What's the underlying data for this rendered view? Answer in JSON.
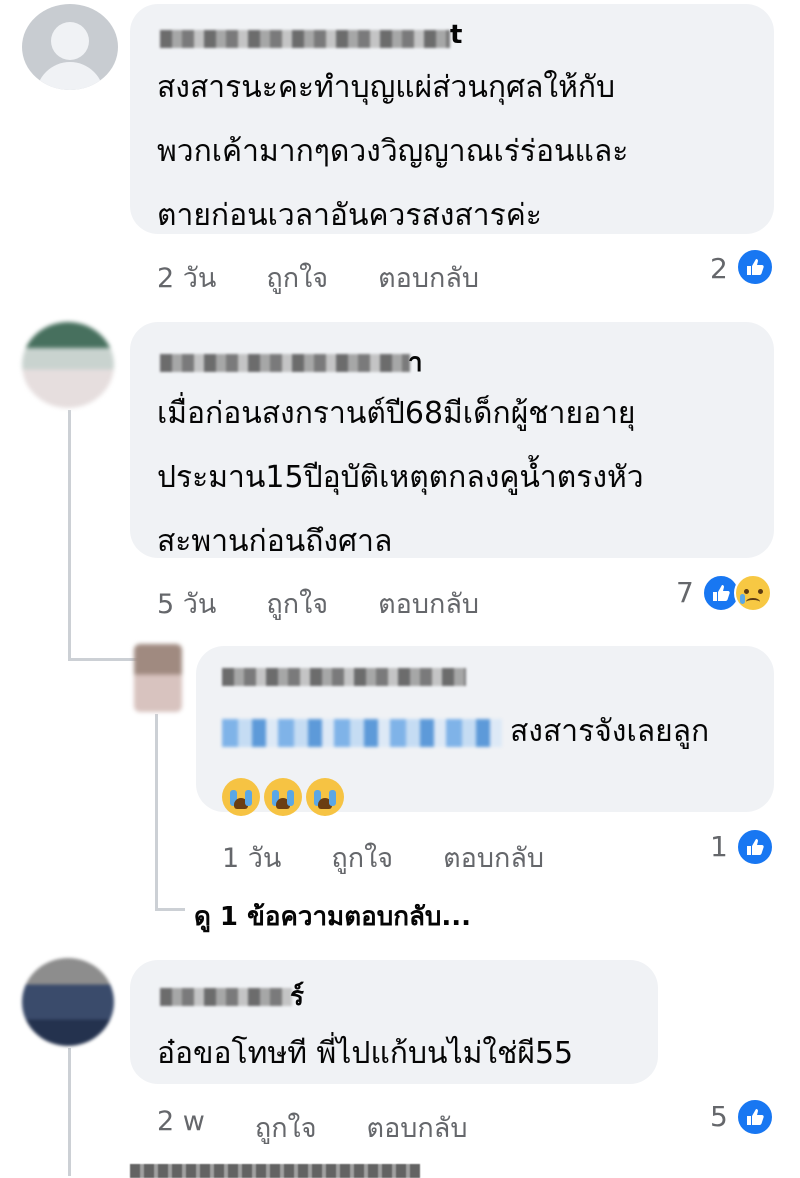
{
  "colors": {
    "like_blue": "#1877f2",
    "bubble": "#f0f2f5",
    "meta_gray": "#65676b"
  },
  "comments": [
    {
      "name_suffix": "t",
      "lines": [
        "สงสารนะคะทำบุญแผ่ส่วนกุศลให้กับ",
        "พวกเค้ามากๆดวงวิญญาณเร่ร่อนและ",
        "ตายก่อนเวลาอันควรสงสารค่ะ"
      ],
      "time": "2 วัน",
      "like_label": "ถูกใจ",
      "reply_label": "ตอบกลับ",
      "reaction_count": "2",
      "reactions": [
        "like-icon"
      ]
    },
    {
      "name_suffix": "า",
      "lines": [
        "เมื่อก่อนสงกรานต์ปี68มีเด็กผู้ชายอายุ",
        "ประมาน15ปีอุบัติเหตุตกลงคูน้ำตรงหัว",
        "สะพานก่อนถึงศาล"
      ],
      "time": "5 วัน",
      "like_label": "ถูกใจ",
      "reply_label": "ตอบกลับ",
      "reaction_count": "7",
      "reactions": [
        "like-icon",
        "sad-icon"
      ]
    },
    {
      "reply_text": "สงสารจังเลยลูก",
      "emoji": [
        "crying-face",
        "crying-face",
        "crying-face"
      ],
      "time": "1 วัน",
      "like_label": "ถูกใจ",
      "reply_label": "ตอบกลับ",
      "reaction_count": "1",
      "reactions": [
        "like-icon"
      ]
    },
    {
      "view_replies": "ดู 1 ข้อความตอบกลับ..."
    },
    {
      "name_suffix": "ร์",
      "lines": [
        "อ๋อขอโทษที พี่ไปแก้บนไม่ใช่ผี55"
      ],
      "time": "2 w",
      "like_label": "ถูกใจ",
      "reply_label": "ตอบกลับ",
      "reaction_count": "5",
      "reactions": [
        "like-icon"
      ]
    }
  ]
}
